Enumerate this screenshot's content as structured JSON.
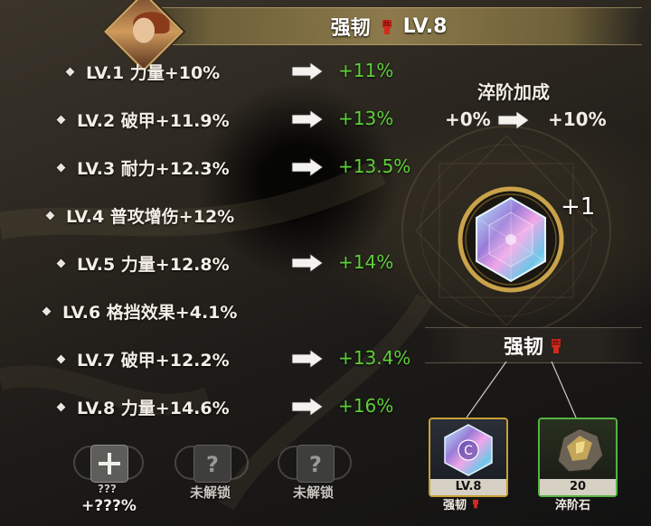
{
  "header": {
    "title": "强韧",
    "level": "LV.8"
  },
  "levels": [
    {
      "label": "LV.1  力量+10%",
      "bonus": "+11%"
    },
    {
      "label": "LV.2  破甲+11.9%",
      "bonus": "+13%"
    },
    {
      "label": "LV.3  耐力+12.3%",
      "bonus": "+13.5%"
    },
    {
      "label": "LV.4  普攻增伤+12%",
      "bonus": ""
    },
    {
      "label": "LV.5  力量+12.8%",
      "bonus": "+14%"
    },
    {
      "label": "LV.6  格挡效果+4.1%",
      "bonus": ""
    },
    {
      "label": "LV.7  破甲+12.2%",
      "bonus": "+13.4%"
    },
    {
      "label": "LV.8  力量+14.6%",
      "bonus": "+16%"
    }
  ],
  "temper": {
    "title": "淬阶加成",
    "from": "+0%",
    "to": "+10%",
    "gem_count": "+1"
  },
  "skill": {
    "name": "强韧"
  },
  "materials": [
    {
      "caption": "LV.8",
      "name": "强韧"
    },
    {
      "caption": "20",
      "name": "淬阶石"
    }
  ],
  "slots": [
    {
      "label": "???",
      "value": "+???%"
    },
    {
      "label": "未解锁"
    },
    {
      "label": "未解锁"
    }
  ],
  "colors": {
    "bonus": "#5fcf3a",
    "gold": "#c8a036",
    "green_border": "#55b443",
    "fist_red": "#d22a1e"
  }
}
